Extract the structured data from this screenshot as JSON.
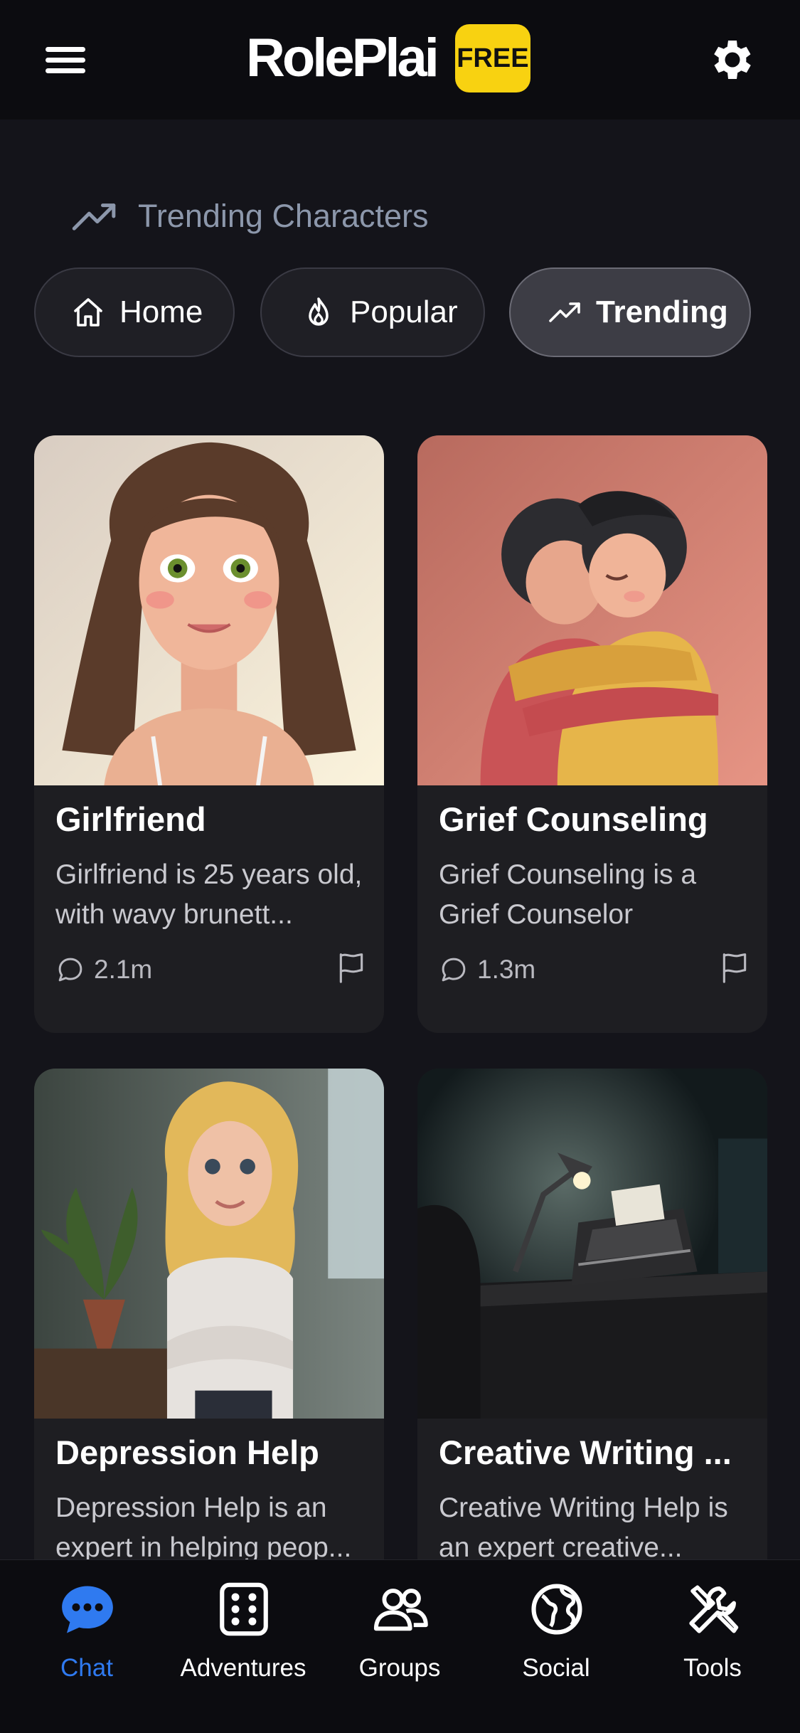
{
  "header": {
    "brand": "RolePlai",
    "badge": "FREE"
  },
  "section": {
    "title": "Trending Characters",
    "icon": "trending-icon"
  },
  "filters": [
    {
      "label": "Home",
      "icon": "home-icon",
      "active": false
    },
    {
      "label": "Popular",
      "icon": "flame-icon",
      "active": false
    },
    {
      "label": "Trending",
      "icon": "trending-icon",
      "active": true
    }
  ],
  "cards": [
    {
      "title": "Girlfriend",
      "description": "Girlfriend is 25 years old, with wavy brunett...",
      "count": "2.1m"
    },
    {
      "title": "Grief Counseling",
      "description": "Grief Counseling is a Grief Counselor",
      "count": "1.3m"
    },
    {
      "title": "Depression Help",
      "description": "Depression Help is an expert in helping peop...",
      "count": ""
    },
    {
      "title": "Creative Writing ...",
      "description": "Creative Writing Help is an expert creative...",
      "count": ""
    }
  ],
  "nav": [
    {
      "label": "Chat",
      "icon": "chat-icon",
      "active": true
    },
    {
      "label": "Adventures",
      "icon": "dice-icon",
      "active": false
    },
    {
      "label": "Groups",
      "icon": "groups-icon",
      "active": false
    },
    {
      "label": "Social",
      "icon": "globe-icon",
      "active": false
    },
    {
      "label": "Tools",
      "icon": "tools-icon",
      "active": false
    }
  ],
  "colors": {
    "accent": "#2f7af0",
    "badge": "#f8d211",
    "background": "#14141a",
    "card": "#1e1e22"
  }
}
